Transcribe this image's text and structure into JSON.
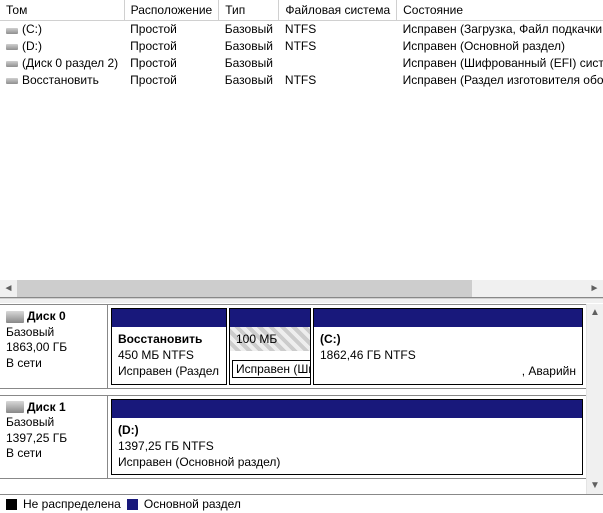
{
  "columns": {
    "c0": "Том",
    "c1": "Расположение",
    "c2": "Тип",
    "c3": "Файловая система",
    "c4": "Состояние"
  },
  "volumes": [
    {
      "name": "(C:)",
      "layout": "Простой",
      "type": "Базовый",
      "fs": "NTFS",
      "status": "Исправен (Загрузка, Файл подкачки,"
    },
    {
      "name": "(D:)",
      "layout": "Простой",
      "type": "Базовый",
      "fs": "NTFS",
      "status": "Исправен (Основной раздел)"
    },
    {
      "name": "(Диск 0 раздел 2)",
      "layout": "Простой",
      "type": "Базовый",
      "fs": "",
      "status": "Исправен (Шифрованный (EFI) систе"
    },
    {
      "name": "Восстановить",
      "layout": "Простой",
      "type": "Базовый",
      "fs": "NTFS",
      "status": "Исправен (Раздел изготовителя обор"
    }
  ],
  "disks": {
    "d0": {
      "name": "Диск 0",
      "type": "Базовый",
      "size": "1863,00 ГБ",
      "online": "В сети",
      "parts": {
        "p0": {
          "title": "Восстановить",
          "line2": "450 МБ NTFS",
          "line3": "Исправен (Раздел"
        },
        "p1": {
          "title": "",
          "line2": "100 МБ",
          "line3": "",
          "tooltip": "Исправен (Шифрованный (EFI) системный раздел)"
        },
        "p2": {
          "title": "(C:)",
          "line2": "1862,46 ГБ NTFS",
          "line3": ", Аварийн"
        }
      }
    },
    "d1": {
      "name": "Диск 1",
      "type": "Базовый",
      "size": "1397,25 ГБ",
      "online": "В сети",
      "parts": {
        "p0": {
          "title": "(D:)",
          "line2": "1397,25 ГБ NTFS",
          "line3": "Исправен (Основной раздел)"
        }
      }
    }
  },
  "legend": {
    "unalloc": "Не распределена",
    "primary": "Основной раздел"
  }
}
